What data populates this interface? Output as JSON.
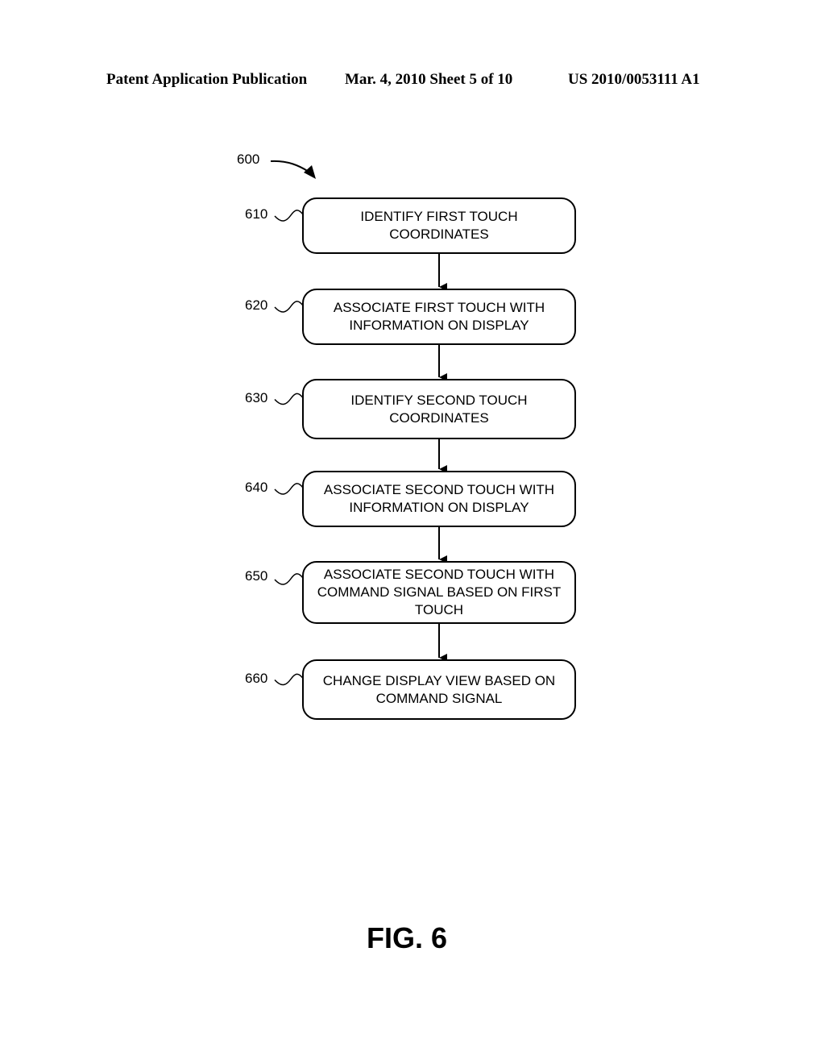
{
  "header": {
    "left": "Patent Application Publication",
    "center": "Mar. 4, 2010   Sheet 5 of 10",
    "right": "US 2010/0053111 A1"
  },
  "diagram": {
    "ref": "600",
    "steps": [
      {
        "ref": "610",
        "text": "IDENTIFY FIRST TOUCH COORDINATES"
      },
      {
        "ref": "620",
        "text": "ASSOCIATE FIRST TOUCH WITH INFORMATION ON DISPLAY"
      },
      {
        "ref": "630",
        "text": "IDENTIFY SECOND TOUCH COORDINATES"
      },
      {
        "ref": "640",
        "text": "ASSOCIATE SECOND TOUCH WITH INFORMATION ON DISPLAY"
      },
      {
        "ref": "650",
        "text": "ASSOCIATE SECOND TOUCH WITH COMMAND SIGNAL BASED ON FIRST TOUCH"
      },
      {
        "ref": "660",
        "text": "CHANGE DISPLAY VIEW BASED ON COMMAND SIGNAL"
      }
    ]
  },
  "figure_label": "FIG. 6"
}
